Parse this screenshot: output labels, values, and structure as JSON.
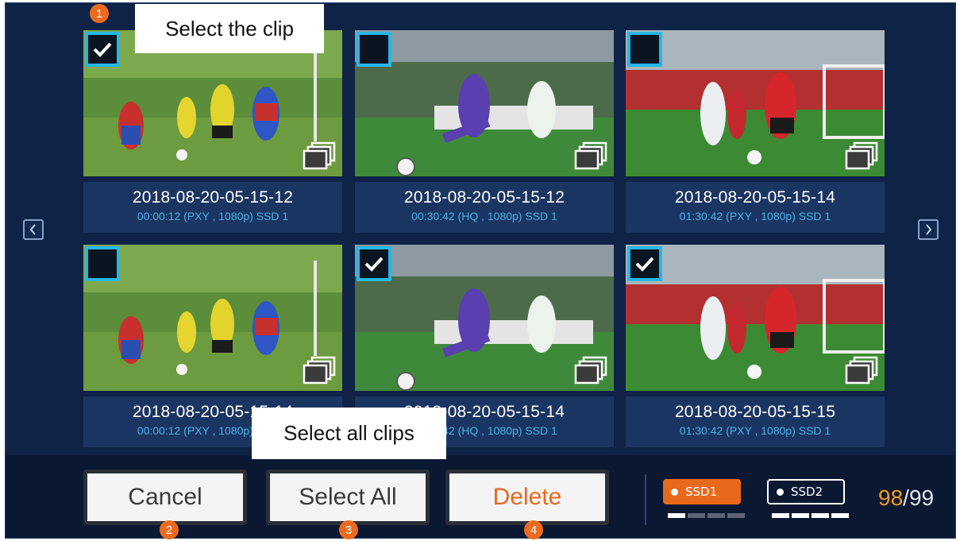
{
  "callouts": {
    "select_clip": "Select the clip",
    "select_all_clips": "Select all clips"
  },
  "clips": [
    {
      "date": "2018-08-20-05-15-12",
      "meta": "00:00:12 (PXY , 1080p) SSD 1",
      "selected": true,
      "thumb": "youth-football"
    },
    {
      "date": "2018-08-20-05-15-12",
      "meta": "00:30:42 (HQ , 1080p) SSD 1",
      "selected": false,
      "thumb": "striker-kick"
    },
    {
      "date": "2018-08-20-05-15-14",
      "meta": "01:30:42 (PXY , 1080p) SSD 1",
      "selected": false,
      "thumb": "red-vs-white"
    },
    {
      "date": "2018-08-20-05-15-14",
      "meta": "00:00:12 (PXY , 1080p) SSD 1",
      "selected": false,
      "thumb": "youth-football"
    },
    {
      "date": "2018-08-20-05-15-14",
      "meta": "00:30:42 (HQ , 1080p) SSD 1",
      "selected": true,
      "thumb": "striker-kick"
    },
    {
      "date": "2018-08-20-05-15-15",
      "meta": "01:30:42 (PXY , 1080p) SSD 1",
      "selected": true,
      "thumb": "red-vs-white"
    }
  ],
  "nav": {
    "prev_icon": "chevron-left-icon",
    "next_icon": "chevron-right-icon"
  },
  "buttons": {
    "cancel": "Cancel",
    "select_all": "Select All",
    "delete": "Delete"
  },
  "badges": [
    "1",
    "2",
    "3",
    "4"
  ],
  "storage": {
    "ssd1": {
      "label": "SSD1",
      "active": true,
      "level_bars": 4,
      "filled_bars": 1
    },
    "ssd2": {
      "label": "SSD2",
      "active": false,
      "level_bars": 4,
      "filled_bars": 4
    },
    "count_used": "98",
    "count_separator": "/",
    "count_total": "99"
  },
  "colors": {
    "background": "#0f2347",
    "caption_bg": "#1b3562",
    "meta_text": "#46b5e8",
    "checkbox_border": "#27b7e6",
    "accent_orange": "#e8691c",
    "count_used": "#f29a1e"
  }
}
